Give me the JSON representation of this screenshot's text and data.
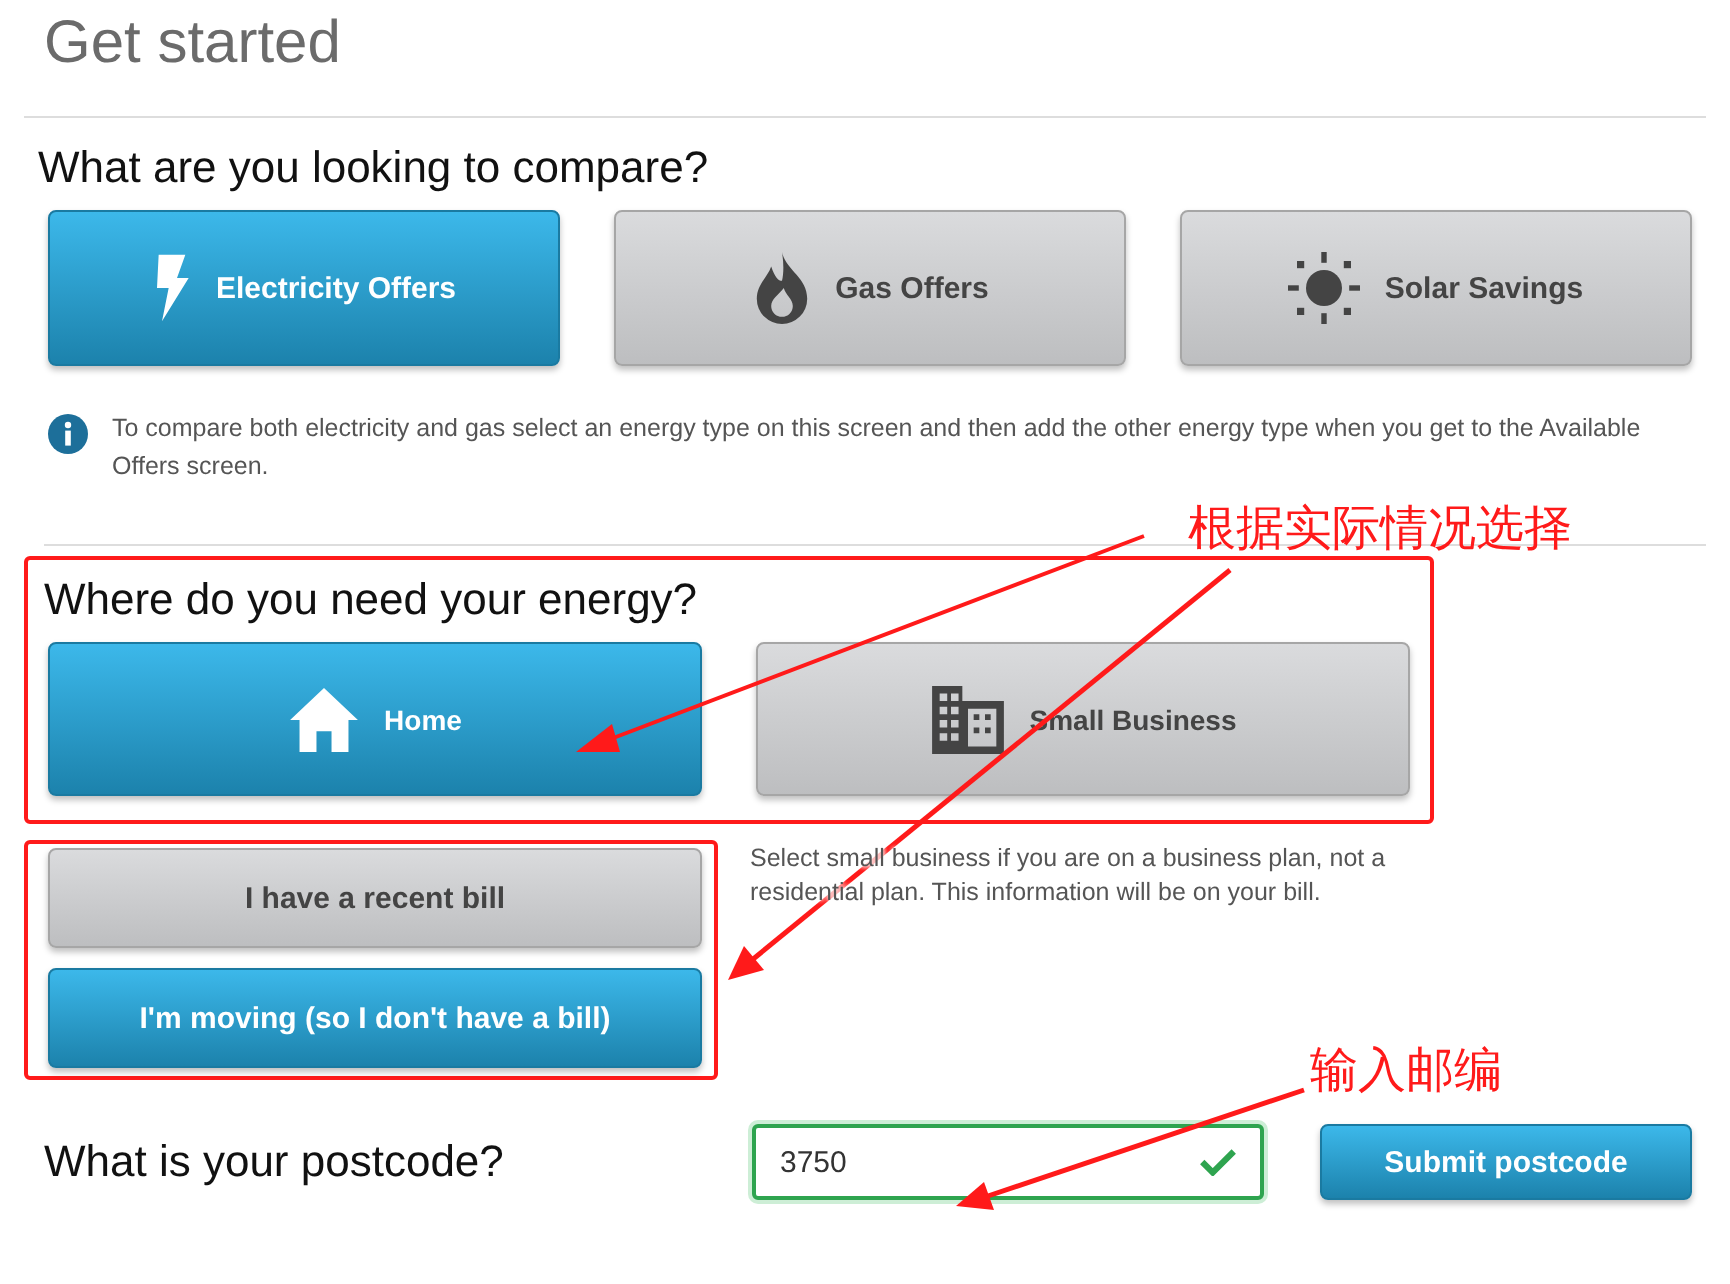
{
  "page_title": "Get started",
  "compare": {
    "heading": "What are you looking to compare?",
    "options": [
      {
        "label": "Electricity Offers",
        "kind": "bolt",
        "selected": true
      },
      {
        "label": "Gas Offers",
        "kind": "flame",
        "selected": false
      },
      {
        "label": "Solar Savings",
        "kind": "sun",
        "selected": false
      }
    ],
    "info": "To compare both electricity and gas select an energy type on this screen and then add the other energy type when you get to the Available Offers screen."
  },
  "location": {
    "heading": "Where do you need your energy?",
    "options": [
      {
        "label": "Home",
        "kind": "house",
        "selected": true
      },
      {
        "label": "Small Business",
        "kind": "building",
        "selected": false
      }
    ],
    "help": "Select small business if you are on a business plan, not a residential plan. This information will be on your bill."
  },
  "bill": {
    "options": [
      {
        "label": "I have a recent bill",
        "selected": false
      },
      {
        "label": "I'm moving (so I don't have a bill)",
        "selected": true
      }
    ]
  },
  "postcode": {
    "label": "What is your postcode?",
    "value": "3750",
    "valid": true,
    "submit": "Submit postcode"
  },
  "annotations": [
    {
      "text": "根据实际情况选择"
    },
    {
      "text": "输入邮编"
    }
  ]
}
